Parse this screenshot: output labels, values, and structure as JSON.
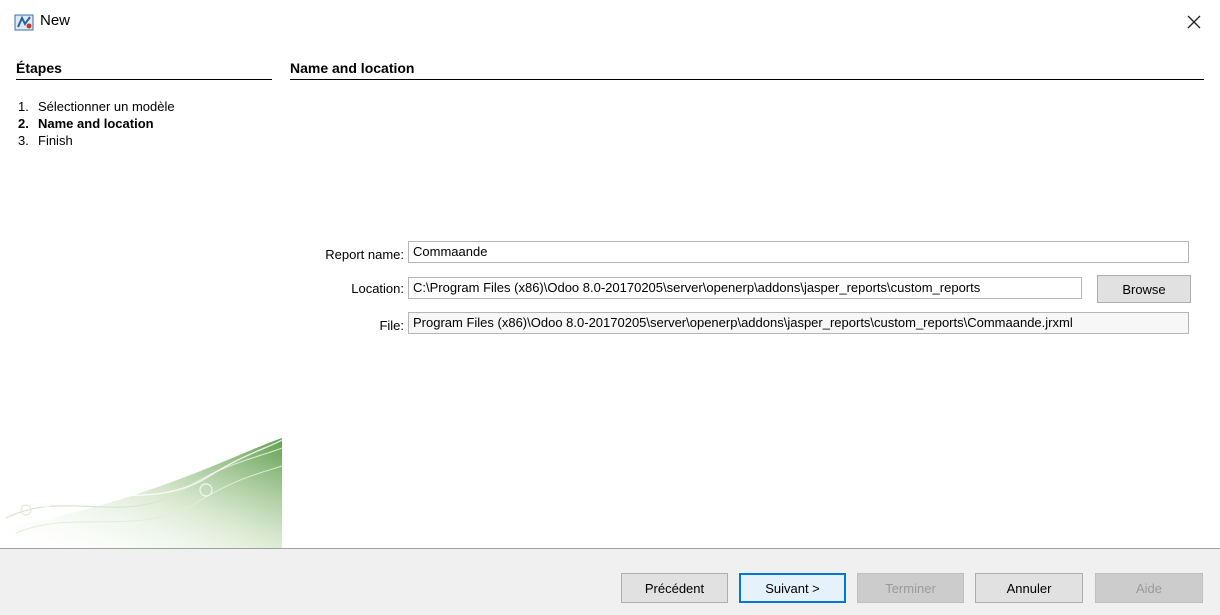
{
  "window": {
    "title": "New",
    "icon": "jaspersoft-app-icon",
    "close_icon": "close-icon"
  },
  "steps": {
    "heading": "Étapes",
    "items": [
      {
        "num": "1.",
        "label": "Sélectionner un modèle",
        "active": false
      },
      {
        "num": "2.",
        "label": "Name and location",
        "active": true
      },
      {
        "num": "3.",
        "label": "Finish",
        "active": false
      }
    ]
  },
  "content": {
    "heading": "Name and location",
    "report_name": {
      "label": "Report name:",
      "value": "Commaande"
    },
    "location": {
      "label": "Location:",
      "value": "C:\\Program Files (x86)\\Odoo 8.0-20170205\\server\\openerp\\addons\\jasper_reports\\custom_reports"
    },
    "file": {
      "label": "File:",
      "value": "Program Files (x86)\\Odoo 8.0-20170205\\server\\openerp\\addons\\jasper_reports\\custom_reports\\Commaande.jrxml"
    },
    "browse_label": "Browse"
  },
  "buttons": {
    "previous": "Précédent",
    "next": "Suivant >",
    "finish": "Terminer",
    "cancel": "Annuler",
    "help": "Aide"
  },
  "colors": {
    "accent": "#0078d7",
    "footer_bg": "#f0f0f0",
    "swirl_green": "#7fb069"
  }
}
